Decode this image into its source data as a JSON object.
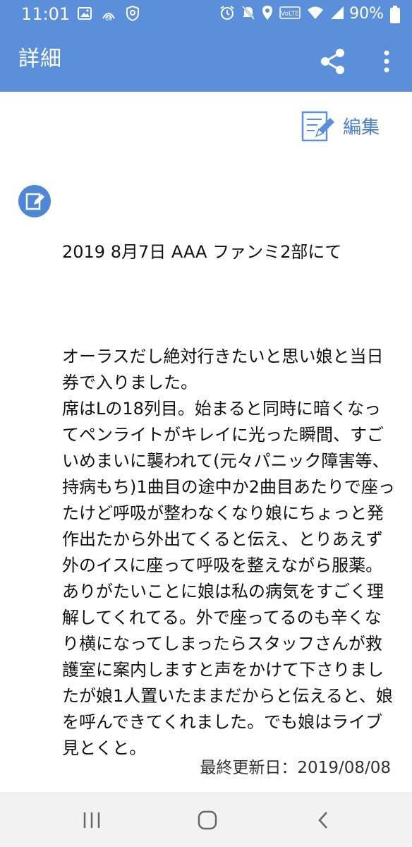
{
  "status_bar": {
    "time": "11:01",
    "battery_percent": "90%",
    "icons": [
      "image-icon",
      "wifi-call-icon",
      "shield-icon",
      "alarm-icon",
      "mute-icon",
      "location-icon",
      "volte-icon",
      "wifi-icon",
      "signal-icon",
      "battery-icon"
    ],
    "volte_label": "VoLTE"
  },
  "app_bar": {
    "title": "詳細",
    "actions": [
      "share-icon",
      "more-vert-icon"
    ]
  },
  "edit": {
    "label": "編集",
    "icon": "edit-document-icon"
  },
  "entry": {
    "icon": "note-edit-icon",
    "date_title": "2019 8月7日 AAA ファンミ2部にて",
    "text": "オーラスだし絶対行きたいと思い娘と当日券で入りました。\n席はLの18列目。始まると同時に暗くなってペンライトがキレイに光った瞬間、すごいめまいに襲われて(元々パニック障害等、持病もち)1曲目の途中か2曲目あたりで座ったけど呼吸が整わなくなり娘にちょっと発作出たから外出てくると伝え、とりあえず外のイスに座って呼吸を整えながら服薬。ありがたいことに娘は私の病気をすごく理解してくれてる。外で座ってるのも辛くなり横になってしまったらスタッフさんが救護室に案内しますと声をかけて下さりましたが娘1人置いたままだからと伝えると、娘を呼んできてくれました。でも娘はライブ見とくと。"
  },
  "footer": {
    "last_updated": "最終更新日：2019/08/08"
  },
  "nav_bar": {
    "buttons": [
      "recent-apps-icon",
      "home-icon",
      "back-icon"
    ]
  },
  "colors": {
    "primary": "#5b8fd9",
    "accent": "#4a7fcb",
    "nav_bg": "#f2f2f2"
  }
}
